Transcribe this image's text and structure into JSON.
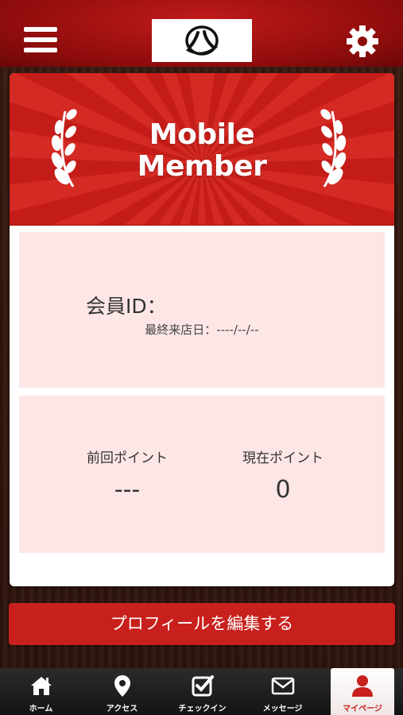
{
  "header": {
    "menu_icon": "hamburger-menu-icon",
    "logo_icon": "hachi-logo",
    "settings_icon": "gear-icon"
  },
  "banner": {
    "line1": "Mobile",
    "line2": "Member"
  },
  "member": {
    "id_label": "会員ID：",
    "last_visit": "最終来店日：----/--/--"
  },
  "points": {
    "previous_label": "前回ポイント",
    "previous_value": "---",
    "current_label": "現在ポイント",
    "current_value": "0"
  },
  "edit_profile_label": "プロフィールを編集する",
  "tabs": [
    {
      "label": "ホーム",
      "icon": "home-icon"
    },
    {
      "label": "アクセス",
      "icon": "map-pin-icon"
    },
    {
      "label": "チェックイン",
      "icon": "checkbox-icon"
    },
    {
      "label": "メッセージ",
      "icon": "envelope-icon"
    },
    {
      "label": "マイページ",
      "icon": "user-icon"
    }
  ],
  "colors": {
    "brand_red": "#c8201c",
    "panel_pink": "#fde6e6"
  }
}
